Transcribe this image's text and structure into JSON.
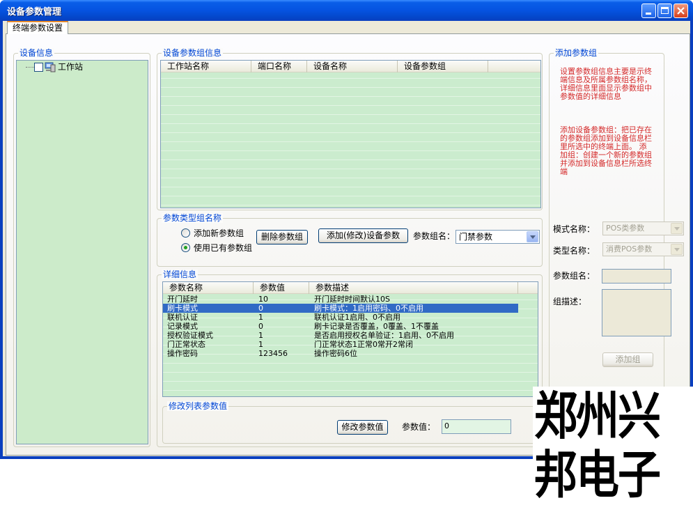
{
  "window": {
    "title": "设备参数管理"
  },
  "tabs": [
    {
      "label": "终端参数设置"
    }
  ],
  "device_info": {
    "label": "设备信息",
    "tree_root": "工作站"
  },
  "param_group_info": {
    "label": "设备参数组信息",
    "columns": [
      "工作站名称",
      "端口名称",
      "设备名称",
      "设备参数组"
    ]
  },
  "param_type": {
    "label": "参数类型组名称",
    "radio_new": "添加新参数组",
    "radio_existing": "使用已有参数组",
    "selected": "使用已有参数组",
    "delete_button": "删除参数组",
    "add_modify_button": "添加(修改)设备参数",
    "group_name_label": "参数组名：",
    "group_name_value": "门禁参数"
  },
  "details": {
    "label": "详细信息",
    "columns": [
      "参数名称",
      "参数值",
      "参数描述"
    ],
    "rows": [
      {
        "name": "开门延时",
        "value": "10",
        "desc": "开门延时时间默认10S"
      },
      {
        "name": "刷卡模式",
        "value": "0",
        "desc": "刷卡模式：1启用密码、0不启用"
      },
      {
        "name": "联机认证",
        "value": "1",
        "desc": "联机认证1启用、0不启用"
      },
      {
        "name": "记录模式",
        "value": "0",
        "desc": "刷卡记录是否覆盖，0覆盖、1不覆盖"
      },
      {
        "name": "授权验证模式",
        "value": "1",
        "desc": "是否启用授权名单验证：1启用、0不启用"
      },
      {
        "name": "门正常状态",
        "value": "1",
        "desc": "门正常状态1正常0常开2常闭"
      },
      {
        "name": "操作密码",
        "value": "123456",
        "desc": "操作密码6位"
      }
    ],
    "selected_row": 1
  },
  "modify": {
    "label": "修改列表参数值",
    "modify_button": "修改参数值",
    "value_label": "参数值：",
    "value": "0"
  },
  "add_group": {
    "label": "添加参数组",
    "help_text_1": "设置参数组信息主要是示终端信息及所属参数组名称，详细信息里面显示参数组中参数值的详细信息",
    "help_text_2": "添加设备参数组：把已存在的参数组添加到设备信息栏里所选中的终端上面。 添加组：创建一个新的参数组并添加到设备信息栏所选终端",
    "mode_label": "模式名称：",
    "mode_value": "POS类参数",
    "type_label": "类型名称：",
    "type_value": "消费POS参数",
    "group_name_label": "参数组名：",
    "group_desc_label": "组描述：",
    "add_button": "添加组"
  },
  "watermark": "郑州兴邦电子",
  "colors": {
    "title_bar": "#0553e0",
    "grid_bg": "#cbecce",
    "selection": "#316ac5",
    "group_label": "#0046d5",
    "help_text": "#d42a2a"
  }
}
